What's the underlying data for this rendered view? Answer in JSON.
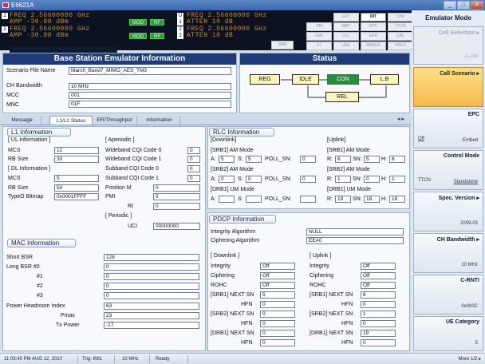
{
  "window": {
    "title": "E6621A",
    "buttons": {
      "min": "_",
      "max": "□",
      "close": "✕"
    }
  },
  "display": {
    "lines": [
      {
        "tag": "1",
        "text": "FREQ  2.56600000 GHz",
        "mod": "MOD",
        "rf": "RF"
      },
      {
        "tag": "1",
        "text": "AMP  -30.00 dBm",
        "mod": "MOD",
        "rf": "RF"
      },
      {
        "tag": "2",
        "text": "FREQ  2.56600000 GHz",
        "mod": "MOD",
        "rf": "RF"
      },
      {
        "tag": "2",
        "text": "AMP  -30.00 dBm",
        "mod": "MOD",
        "rf": "RF"
      }
    ],
    "right_lines": [
      {
        "tag": "U",
        "text": "FREQ  2.56600000 GHz"
      },
      {
        "tag": "1",
        "text": "ATTEN  10 dB"
      },
      {
        "tag": "2",
        "text": "FREQ  2.56600000 GHz"
      },
      {
        "tag": "2",
        "text": "ATTEN  10 dB"
      }
    ],
    "smr": "SMR"
  },
  "mode_buttons": [
    [
      "EXT",
      "INT",
      "10M"
    ],
    [
      "DM",
      "BMT",
      "EPC",
      "TTCN"
    ],
    [
      "OVF",
      "O.C.",
      "ERR",
      "CAL"
    ],
    [
      "UT",
      "UEE",
      "SINGLE",
      "HOLD"
    ]
  ],
  "sidebar": {
    "title": "Emulator Mode",
    "items": [
      {
        "title": "Cell Selection ▸",
        "value": "A-Cell"
      },
      {
        "title": "Call Scenario ▸",
        "value": ""
      },
      {
        "title": "EPC",
        "left": "Off",
        "value": "Embed"
      },
      {
        "title": "Control Mode",
        "left": "TTCN",
        "value": "Standalone"
      },
      {
        "title": "Spec. Version ▸",
        "value": "2009-03"
      },
      {
        "title": "CH Bandwidth ▸",
        "value": "10 MHz"
      },
      {
        "title": "C-RNTI",
        "value": "0x000C"
      },
      {
        "title": "UE Category",
        "value": "5"
      }
    ],
    "more": "More 1/2 ▸"
  },
  "bse": {
    "title": "Base Station Emulator Information",
    "scenario_label": "Scenario File Name",
    "scenario_value": "March_Band7_MIMO_AES_TM3",
    "chbw_label": "CH Bandwidth",
    "chbw_value": "10 MHz",
    "mcc_label": "MCC",
    "mcc_value": "001",
    "mnc_label": "MNC",
    "mnc_value": "01F"
  },
  "status": {
    "title": "Status",
    "reg": "REG",
    "idle": "IDLE",
    "con": "CON",
    "lb": "L.B",
    "rel": "REL"
  },
  "tabs": [
    "Message",
    "L1/L2 Status",
    "ER/Throughput",
    "Information"
  ],
  "tab_arrows": "◂ ▸",
  "l1": {
    "title": "L1 Information",
    "ul": "[ UL information ]",
    "aper": "[ Aperiodic ]",
    "mcs_label": "MCS",
    "mcs_ul": "12",
    "rb_label": "RB Size",
    "rb_ul": "30",
    "dl": "[ DL Information ]",
    "mcs_dl": "5",
    "rb_dl": "50",
    "typeo_label": "TypeO Bitmap",
    "typeo": "0x0001FFFF",
    "wb0": "Wideband CQI Code 0",
    "wb0v": "0",
    "wb1": "Wideband CQI Code 1",
    "wb1v": "0",
    "sb0": "Subband CQI Code 0",
    "sb0v": "0",
    "sb1": "Subband CQI Code 1",
    "sb1v": "0",
    "pos": "Position M",
    "posv": "0",
    "pmi": "PMI",
    "pmiv": "0",
    "ri": "RI",
    "riv": "0",
    "periodic": "[ Periodic ]",
    "uci": "UCI",
    "uciv": "00000000"
  },
  "mac": {
    "title": "MAC Information",
    "short_bsr": "Short BSR",
    "short_bsr_v": "128",
    "long_bsr": "Long BSR #0",
    "lb0": "0",
    "n1": "#1",
    "lb1": "0",
    "n2": "#2",
    "lb2": "0",
    "n3": "#3",
    "lb3": "0",
    "phr": "Power Headroom Index",
    "phr_v": "63",
    "pmax": "Pmax",
    "pmax_v": "23",
    "txp": "Tx Power",
    "txp_v": "-17"
  },
  "rlc": {
    "title": "RLC Information",
    "dl": "[Downlink]",
    "ul": "[Uplink]",
    "srb1": "[SRB1] AM Mode",
    "srb2": "[SRB2] AM Mode",
    "drb1": "[DRB1] UM Mode",
    "a": "A:",
    "s": "S:",
    "r": "R:",
    "h": "H:",
    "sn": "SN:",
    "poll": "POLL_SN:",
    "dl_srb1": {
      "a": "5",
      "s": "5",
      "poll": "0"
    },
    "dl_srb2": {
      "a": "0",
      "s": "0",
      "poll": "0"
    },
    "dl_drb1": {
      "a": "",
      "s": "",
      "poll": ""
    },
    "ul_srb1": {
      "r": "6",
      "sn": "5",
      "h": "6"
    },
    "ul_srb2": {
      "r": "1",
      "sn": "0",
      "h": "1"
    },
    "ul_drb1": {
      "r": "19",
      "sn": "18",
      "h": "19"
    }
  },
  "pdcp": {
    "title": "PDCP Information",
    "int_alg": "Integrity Algorithm",
    "int_alg_v": "NULL",
    "ciph_alg": "Ciphering Algorithm",
    "ciph_alg_v": "EEA0",
    "dl": "[ Downlink ]",
    "ul": "[ Uplink ]",
    "integrity": "Integrity",
    "ciphering": "Ciphering",
    "rohc": "ROHC",
    "dl_int": "Off",
    "dl_ciph": "Off",
    "dl_rohc": "Off",
    "ul_int": "Off",
    "ul_ciph": "Off",
    "ul_rohc": "Off",
    "srb1": "[SRB1] NEXT SN",
    "srb2": "[SRB2] NEXT SN",
    "drb1": "[DRB1] NEXT SN",
    "hfn": "HFN",
    "dl_srb1_sn": "5",
    "dl_srb1_hfn": "0",
    "dl_srb2_sn": "0",
    "dl_srb2_hfn": "0",
    "dl_drb1_sn": "0",
    "dl_drb1_hfn": "0",
    "ul_srb1_sn": "6",
    "ul_srb1_hfn": "0",
    "ul_srb2_sn": "1",
    "ul_srb2_hfn": "0",
    "ul_drb1_sn": "19",
    "ul_drb1_hfn": "0"
  },
  "statusbar": {
    "time": "11:03:45 PM AUG 12, 2010",
    "trig": "Trig: IMI1",
    "bw": "10 MHz",
    "state": "Ready"
  }
}
